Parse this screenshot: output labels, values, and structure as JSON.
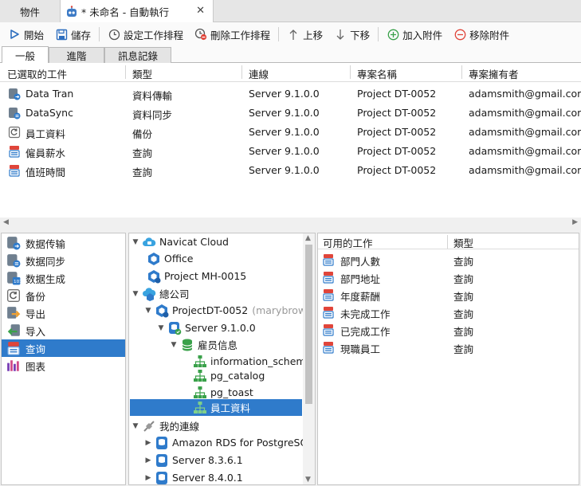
{
  "window_tabs": {
    "objects": "物件",
    "job": "* 未命名 - 自動執行",
    "close": "✕"
  },
  "toolbar": {
    "start": "開始",
    "save": "儲存",
    "set_schedule": "設定工作排程",
    "delete_schedule": "刪除工作排程",
    "move_up": "上移",
    "move_down": "下移",
    "add_attachment": "加入附件",
    "remove_attachment": "移除附件"
  },
  "subtabs": [
    "一般",
    "進階",
    "訊息記錄"
  ],
  "job_grid": {
    "headers": [
      "已選取的工件",
      "類型",
      "連線",
      "專案名稱",
      "專案擁有者"
    ],
    "rows": [
      {
        "name": "Data Tran",
        "type": "資料傳輸",
        "connection": "Server 9.1.0.0",
        "project": "Project DT-0052",
        "owner": "adamsmith@gmail.com",
        "icon": "data-transfer-icon"
      },
      {
        "name": "DataSync",
        "type": "資料同步",
        "connection": "Server 9.1.0.0",
        "project": "Project DT-0052",
        "owner": "adamsmith@gmail.com",
        "icon": "data-sync-icon"
      },
      {
        "name": "員工資料",
        "type": "備份",
        "connection": "Server 9.1.0.0",
        "project": "Project DT-0052",
        "owner": "adamsmith@gmail.com",
        "icon": "backup-icon"
      },
      {
        "name": "僱員薪水",
        "type": "查詢",
        "connection": "Server 9.1.0.0",
        "project": "Project DT-0052",
        "owner": "adamsmith@gmail.com",
        "icon": "query-icon"
      },
      {
        "name": "值班時間",
        "type": "查詢",
        "connection": "Server 9.1.0.0",
        "project": "Project DT-0052",
        "owner": "adamsmith@gmail.com",
        "icon": "query-icon"
      }
    ]
  },
  "job_types": [
    {
      "label": "数据传输",
      "icon": "data-transfer-icon",
      "selected": false
    },
    {
      "label": "数据同步",
      "icon": "data-sync-icon",
      "selected": false
    },
    {
      "label": "数据生成",
      "icon": "data-generation-icon",
      "selected": false
    },
    {
      "label": "备份",
      "icon": "backup-icon",
      "selected": false
    },
    {
      "label": "导出",
      "icon": "export-icon",
      "selected": false
    },
    {
      "label": "导入",
      "icon": "import-icon",
      "selected": false
    },
    {
      "label": "查询",
      "icon": "query-icon",
      "selected": true
    },
    {
      "label": "图表",
      "icon": "chart-icon",
      "selected": false
    }
  ],
  "tree": {
    "navicat_cloud": "Navicat Cloud",
    "office": "Office",
    "project_mh": "Project MH-0015",
    "head_office": "總公司",
    "project_dt": "ProjectDT-0052",
    "project_dt_owner": "(marybrown",
    "server_910": "Server 9.1.0.0",
    "db_employee": "雇员信息",
    "schema_info": "information_schema",
    "schema_catalog": "pg_catalog",
    "schema_toast": "pg_toast",
    "schema_employee": "員工資料",
    "my_connections": "我的連線",
    "amazon_rds": "Amazon RDS for PostgreSQL",
    "server_836": "Server 8.3.6.1",
    "server_840": "Server 8.4.0.1"
  },
  "available": {
    "headers": [
      "可用的工作",
      "類型"
    ],
    "rows": [
      {
        "name": "部門人數",
        "type": "查詢"
      },
      {
        "name": "部門地址",
        "type": "查詢"
      },
      {
        "name": "年度薪酬",
        "type": "查詢"
      },
      {
        "name": "未完成工作",
        "type": "查詢"
      },
      {
        "name": "已完成工作",
        "type": "查詢"
      },
      {
        "name": "現職員工",
        "type": "查詢"
      }
    ]
  },
  "colors": {
    "selection": "#2f7bcb",
    "accent_blue": "#2f7bcb",
    "query_red": "#e0453a",
    "add_green": "#3aa14a",
    "remove_red": "#e0453a"
  }
}
